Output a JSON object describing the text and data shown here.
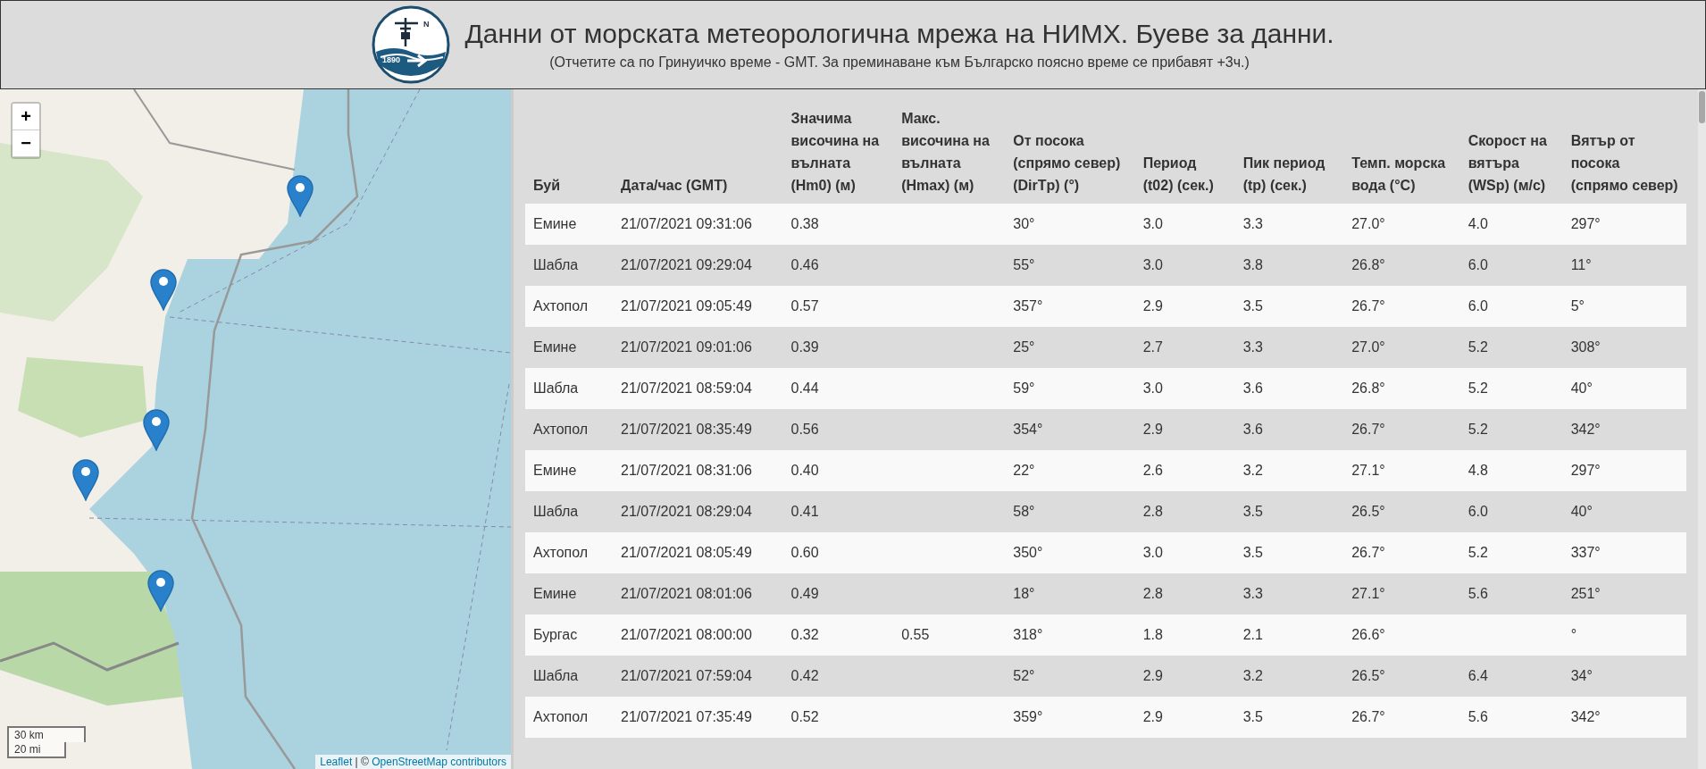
{
  "header": {
    "logo": {
      "year": "1890",
      "letter": "N"
    },
    "title": "Данни от морската метеорологична мрежа на НИМХ. Буеве за данни.",
    "subtitle": "(Отчетите са по Гринуичко време - GMT. За преминаване към Българско поясно време се прибавят +3ч.)"
  },
  "map": {
    "zoom_in": "+",
    "zoom_out": "−",
    "scale": [
      "30 km",
      "20 mi"
    ],
    "attribution": {
      "leaflet": "Leaflet",
      "separator": " | © ",
      "osm": "OpenStreetMap contributors"
    }
  },
  "table": {
    "columns": [
      "Буй",
      "Дата/час (GMT)",
      "Значима височина на вълната (Hm0) (м)",
      "Макс. височина на вълната (Hmax) (м)",
      "От посока (спрямо север) (DirTp) (°)",
      "Период (t02) (сек.)",
      "Пик период (tp) (сек.)",
      "Темп. морска вода (°C)",
      "Скорост на вятъра (WSp) (м/с)",
      "Вятър от посока (спрямо север)"
    ],
    "rows": [
      [
        "Емине",
        "21/07/2021 09:31:06",
        "0.38",
        null,
        "30°",
        "3.0",
        "3.3",
        "27.0°",
        "4.0",
        "297°"
      ],
      [
        "Шабла",
        "21/07/2021 09:29:04",
        "0.46",
        null,
        "55°",
        "3.0",
        "3.8",
        "26.8°",
        "6.0",
        "11°"
      ],
      [
        "Ахтопол",
        "21/07/2021 09:05:49",
        "0.57",
        null,
        "357°",
        "2.9",
        "3.5",
        "26.7°",
        "6.0",
        "5°"
      ],
      [
        "Емине",
        "21/07/2021 09:01:06",
        "0.39",
        null,
        "25°",
        "2.7",
        "3.3",
        "27.0°",
        "5.2",
        "308°"
      ],
      [
        "Шабла",
        "21/07/2021 08:59:04",
        "0.44",
        null,
        "59°",
        "3.0",
        "3.6",
        "26.8°",
        "5.2",
        "40°"
      ],
      [
        "Ахтопол",
        "21/07/2021 08:35:49",
        "0.56",
        null,
        "354°",
        "2.9",
        "3.6",
        "26.7°",
        "5.2",
        "342°"
      ],
      [
        "Емине",
        "21/07/2021 08:31:06",
        "0.40",
        null,
        "22°",
        "2.6",
        "3.2",
        "27.1°",
        "4.8",
        "297°"
      ],
      [
        "Шабла",
        "21/07/2021 08:29:04",
        "0.41",
        null,
        "58°",
        "2.8",
        "3.5",
        "26.5°",
        "6.0",
        "40°"
      ],
      [
        "Ахтопол",
        "21/07/2021 08:05:49",
        "0.60",
        null,
        "350°",
        "3.0",
        "3.5",
        "26.7°",
        "5.2",
        "337°"
      ],
      [
        "Емине",
        "21/07/2021 08:01:06",
        "0.49",
        null,
        "18°",
        "2.8",
        "3.3",
        "27.1°",
        "5.6",
        "251°"
      ],
      [
        "Бургас",
        "21/07/2021 08:00:00",
        "0.32",
        "0.55",
        "318°",
        "1.8",
        "2.1",
        "26.6°",
        null,
        "°"
      ],
      [
        "Шабла",
        "21/07/2021 07:59:04",
        "0.42",
        null,
        "52°",
        "2.9",
        "3.2",
        "26.5°",
        "6.4",
        "34°"
      ],
      [
        "Ахтопол",
        "21/07/2021 07:35:49",
        "0.52",
        null,
        "359°",
        "2.9",
        "3.5",
        "26.7°",
        "5.6",
        "342°"
      ]
    ]
  }
}
